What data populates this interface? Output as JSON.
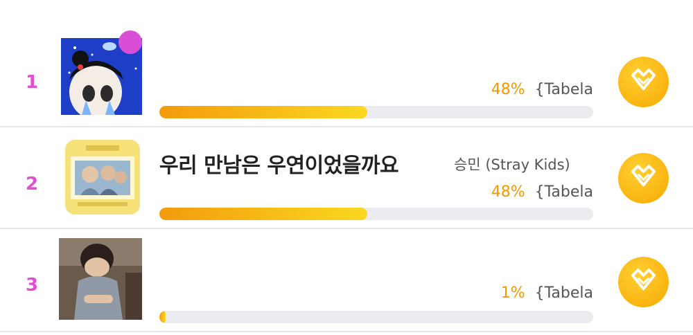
{
  "items": [
    {
      "rank": "1",
      "title": "",
      "artist": "",
      "percent_text": "48%",
      "percent_value": 48,
      "extra": "{Tabela"
    },
    {
      "rank": "2",
      "title": "우리 만남은 우연이었을까요",
      "artist": "승민 (Stray Kids)",
      "percent_text": "48%",
      "percent_value": 48,
      "extra": "{Tabela"
    },
    {
      "rank": "3",
      "title": "",
      "artist": "",
      "percent_text": "1%",
      "percent_value": 1,
      "extra": "{Tabela"
    }
  ],
  "colors": {
    "rank": "#e24fd0",
    "percent": "#ef9a00",
    "bar_start": "#f39b0c",
    "bar_end": "#fbd820",
    "vote_button": "#f7b500"
  },
  "icons": {
    "vote": "heart-vote-icon"
  }
}
